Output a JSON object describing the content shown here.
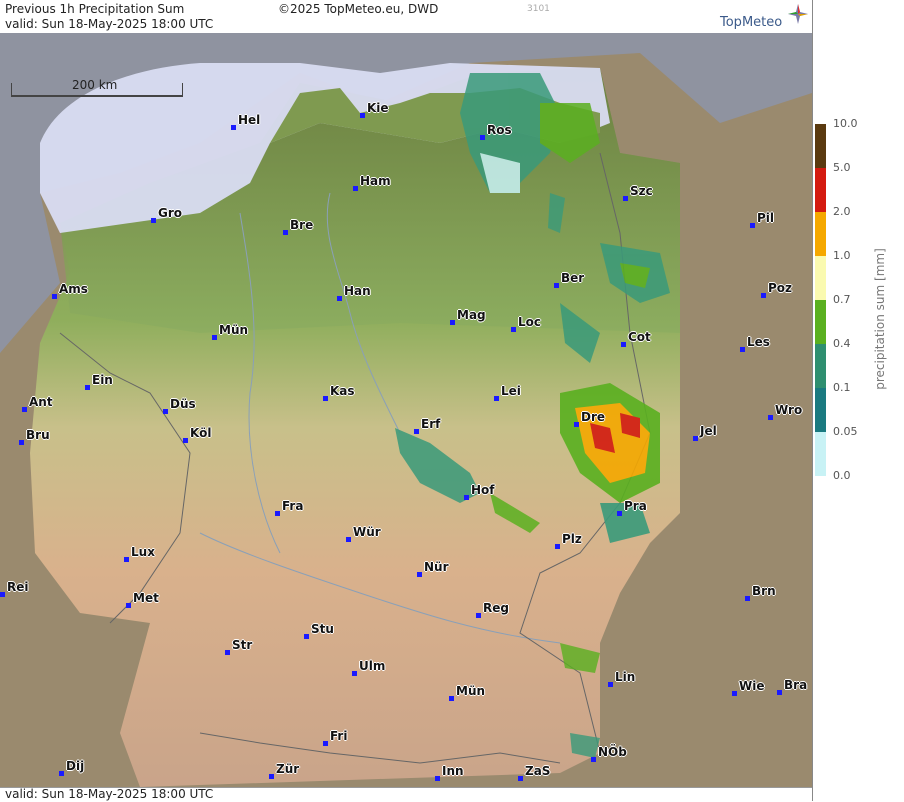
{
  "header": {
    "title": "Previous 1h Precipitation Sum",
    "copyright": "©2025 TopMeteo.eu, DWD",
    "code": "3101",
    "valid": "valid:  Sun  18-May-2025 18:00 UTC",
    "logo": "TopMeteo"
  },
  "footer": {
    "valid": "valid:  Sun  18-May-2025 18:00 UTC"
  },
  "scale": {
    "label": "200 km"
  },
  "legend": {
    "title": "precipitation sum [mm]",
    "ticks": [
      "10.0",
      "5.0",
      "2.0",
      "1.0",
      "0.7",
      "0.4",
      "0.1",
      "0.05",
      "0.0"
    ],
    "colors": [
      "#5a3a10",
      "#d41a10",
      "#f5a800",
      "#fafab0",
      "#5ab020",
      "#2f8f70",
      "#1a7a80",
      "#c8f2f5"
    ]
  },
  "cities": [
    {
      "name": "Hel"
    },
    {
      "name": "Kie"
    },
    {
      "name": "Ros"
    },
    {
      "name": "Ham"
    },
    {
      "name": "Szc"
    },
    {
      "name": "Gro"
    },
    {
      "name": "Bre"
    },
    {
      "name": "Pil"
    },
    {
      "name": "Ber"
    },
    {
      "name": "Ams"
    },
    {
      "name": "Han"
    },
    {
      "name": "Poz"
    },
    {
      "name": "Mün"
    },
    {
      "name": "Mag"
    },
    {
      "name": "Loc"
    },
    {
      "name": "Cot"
    },
    {
      "name": "Les"
    },
    {
      "name": "Ein"
    },
    {
      "name": "Kas"
    },
    {
      "name": "Lei"
    },
    {
      "name": "Ant"
    },
    {
      "name": "Düs"
    },
    {
      "name": "Wro"
    },
    {
      "name": "Bru"
    },
    {
      "name": "Köl"
    },
    {
      "name": "Erf"
    },
    {
      "name": "Dre"
    },
    {
      "name": "Jel"
    },
    {
      "name": "Hof"
    },
    {
      "name": "Fra"
    },
    {
      "name": "Pra"
    },
    {
      "name": "Wür"
    },
    {
      "name": "Plz"
    },
    {
      "name": "Lux"
    },
    {
      "name": "Nür"
    },
    {
      "name": "Rei"
    },
    {
      "name": "Met"
    },
    {
      "name": "Brn"
    },
    {
      "name": "Reg"
    },
    {
      "name": "Stu"
    },
    {
      "name": "Str"
    },
    {
      "name": "Ulm"
    },
    {
      "name": "Lin"
    },
    {
      "name": "Wie"
    },
    {
      "name": "Bra"
    },
    {
      "name": "Mün"
    },
    {
      "name": "Fri"
    },
    {
      "name": "NÖb"
    },
    {
      "name": "Dij"
    },
    {
      "name": "Zür"
    },
    {
      "name": "ZaS"
    },
    {
      "name": "Inn"
    }
  ]
}
